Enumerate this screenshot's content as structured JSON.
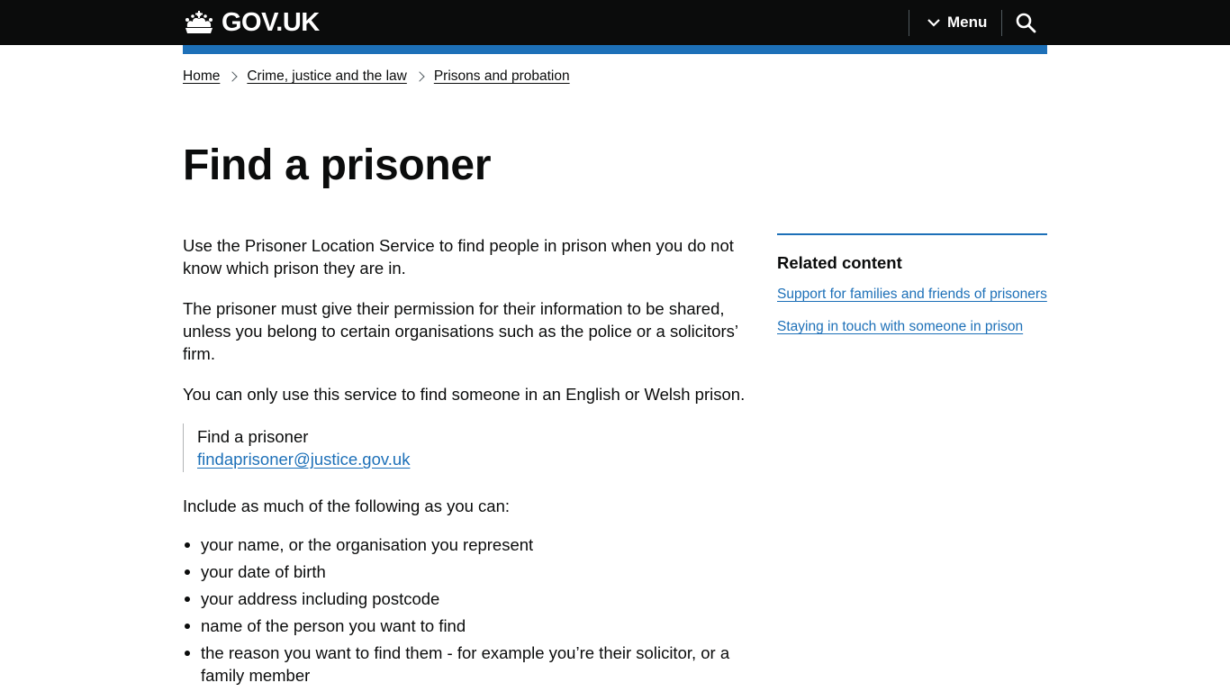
{
  "header": {
    "logo_text": "GOV.UK",
    "menu_label": "Menu",
    "search_icon": "search-icon",
    "crown_icon": "crown-icon",
    "colors": {
      "header_bg": "#0b0c0c",
      "accent": "#1d70b8",
      "link": "#1d70b8"
    }
  },
  "breadcrumbs": [
    {
      "label": "Home"
    },
    {
      "label": "Crime, justice and the law"
    },
    {
      "label": "Prisons and probation"
    }
  ],
  "page_title": "Find a prisoner",
  "main": {
    "paragraphs": [
      "Use the Prisoner Location Service to find people in prison when you do not know which prison they are in.",
      "The prisoner must give their permission for their information to be shared, unless you belong to certain organisations such as the police or a solicitors’ firm.",
      "You can only use this service to find someone in an English or Welsh prison."
    ],
    "contact": {
      "name": "Find a prisoner",
      "email": "findaprisoner@justice.gov.uk"
    },
    "list_intro": "Include as much of the following as you can:",
    "list_items": [
      "your name, or the organisation you represent",
      "your date of birth",
      "your address including postcode",
      "name of the person you want to find",
      "the reason you want to find them - for example you’re their solicitor, or a family member"
    ]
  },
  "related": {
    "title": "Related content",
    "links": [
      "Support for families and friends of prisoners",
      "Staying in touch with someone in prison"
    ]
  }
}
